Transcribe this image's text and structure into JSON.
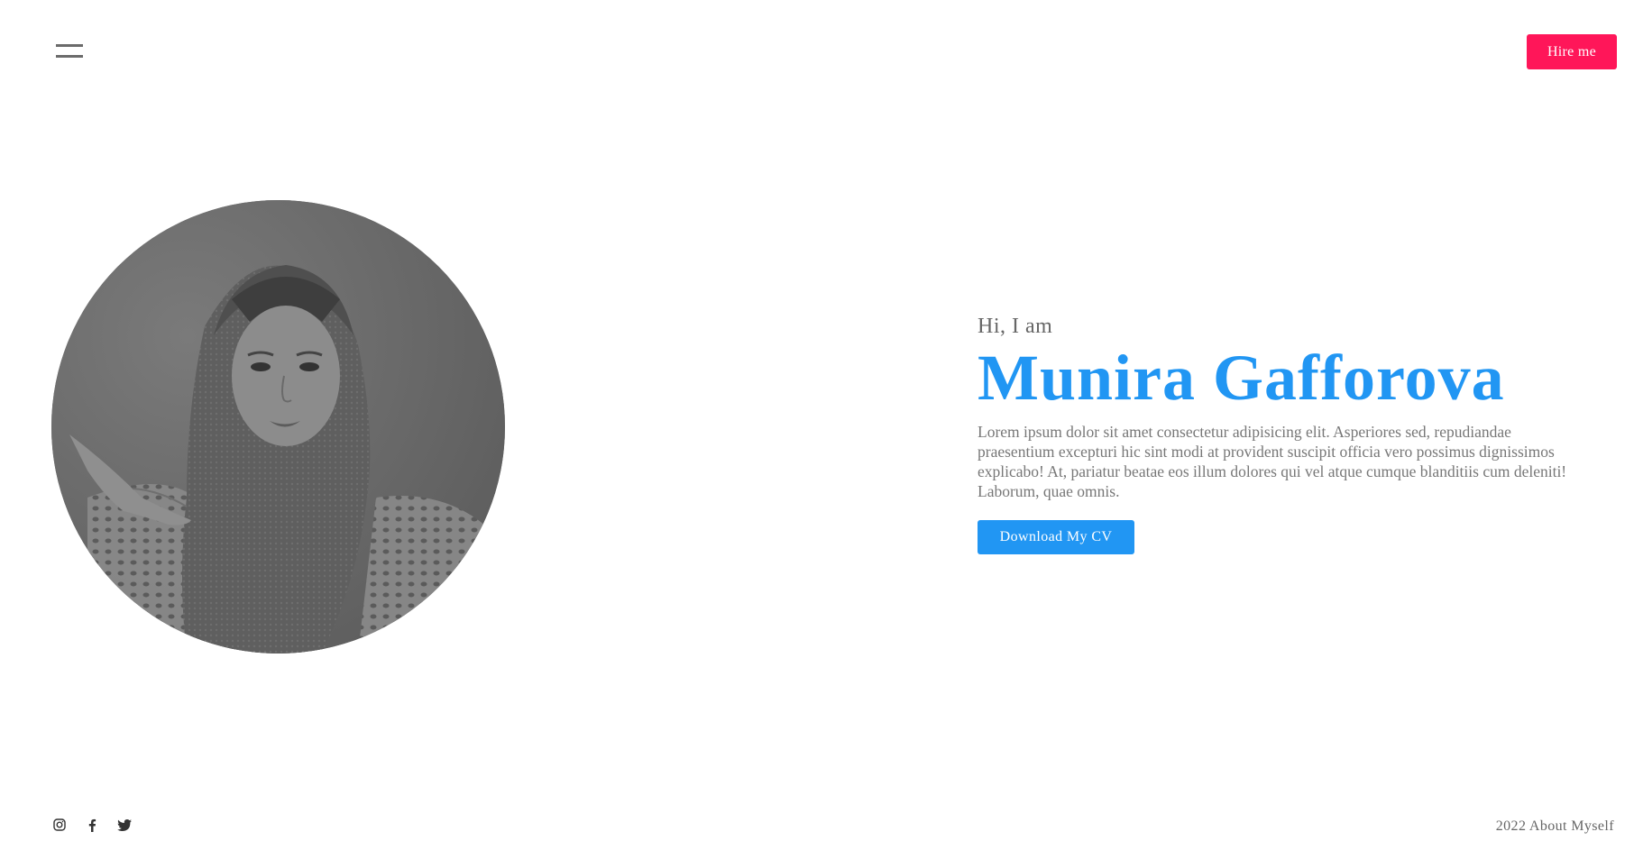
{
  "header": {
    "menu_icon": "hamburger-icon",
    "hire_label": "Hire me"
  },
  "hero": {
    "greeting": "Hi, I am",
    "name": "Munira Gafforova",
    "bio": "Lorem ipsum dolor sit amet consectetur adipisicing elit. Asperiores sed, repudiandae praesentium excepturi hic sint modi at provident suscipit officia vero possimus dignissimos explicabo! At, pariatur beatae eos illum dolores qui vel atque cumque blanditiis cum deleniti! Laborum, quae omnis.",
    "cv_label": "Download My CV",
    "photo": "profile-photo"
  },
  "footer": {
    "socials": [
      "instagram-icon",
      "facebook-icon",
      "twitter-icon"
    ],
    "copyright": "2022 About Myself"
  },
  "colors": {
    "accent_blue": "#2196f3",
    "accent_pink": "#ff1659",
    "text_gray": "#666666"
  }
}
